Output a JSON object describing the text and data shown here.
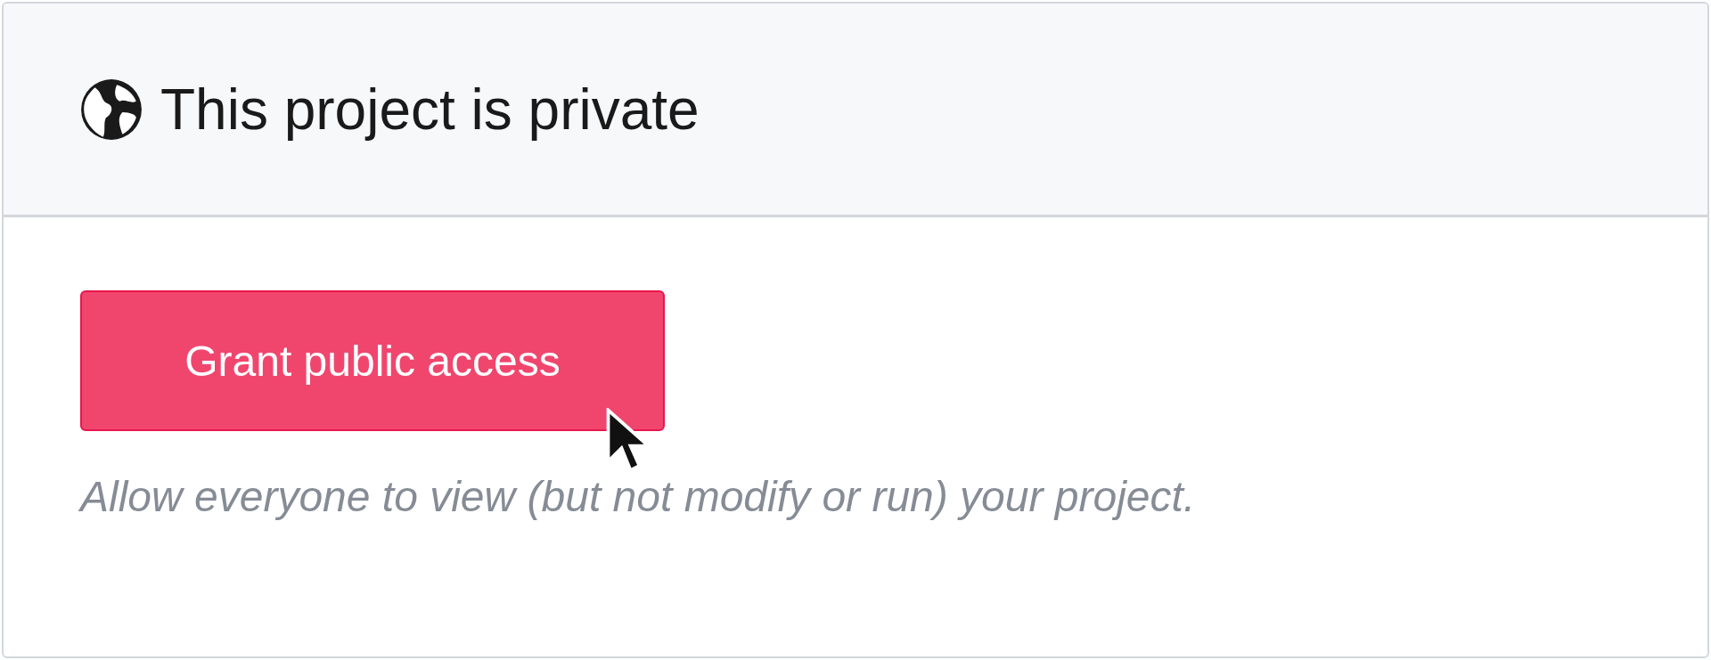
{
  "header": {
    "title": "This project is private"
  },
  "action": {
    "label": "Grant public access"
  },
  "hint": "Allow everyone to view (but not modify or run) your project."
}
